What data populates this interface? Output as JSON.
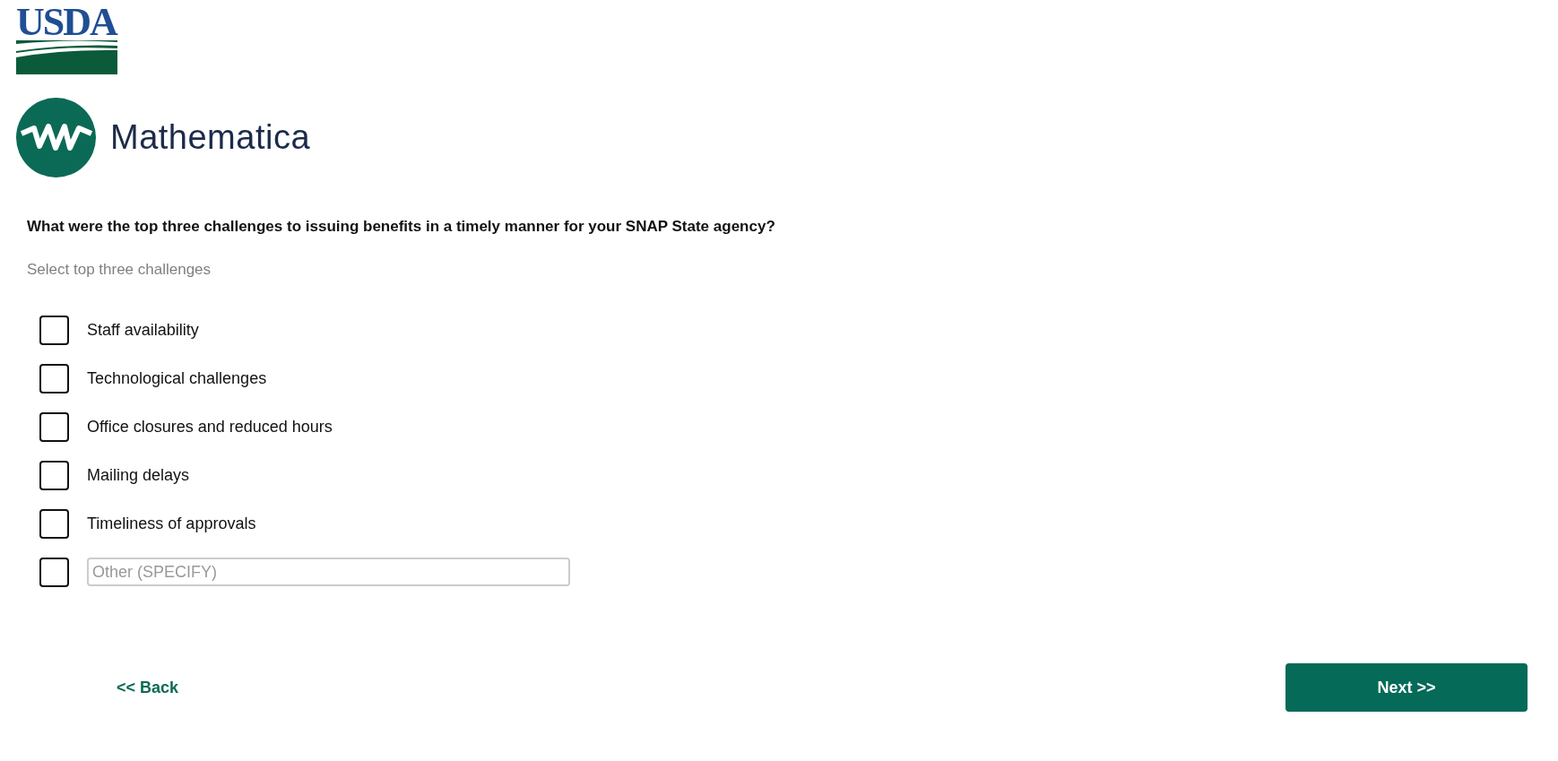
{
  "logos": [
    {
      "kind": "usda",
      "text": "USDA"
    },
    {
      "kind": "mathematica",
      "text": "Mathematica"
    }
  ],
  "question": "What were the top three challenges to issuing benefits in a timely manner for your SNAP State agency?",
  "instruction": "Select top three challenges",
  "options": [
    {
      "kind": "label",
      "label": "Staff availability",
      "checked": false
    },
    {
      "kind": "label",
      "label": "Technological challenges",
      "checked": false
    },
    {
      "kind": "label",
      "label": "Office closures and reduced hours",
      "checked": false
    },
    {
      "kind": "label",
      "label": "Mailing delays",
      "checked": false
    },
    {
      "kind": "label",
      "label": "Timeliness of approvals",
      "checked": false
    },
    {
      "kind": "other",
      "placeholder": "Other (SPECIFY)",
      "checked": false
    }
  ],
  "back": "<< Back",
  "next": "Next >>"
}
